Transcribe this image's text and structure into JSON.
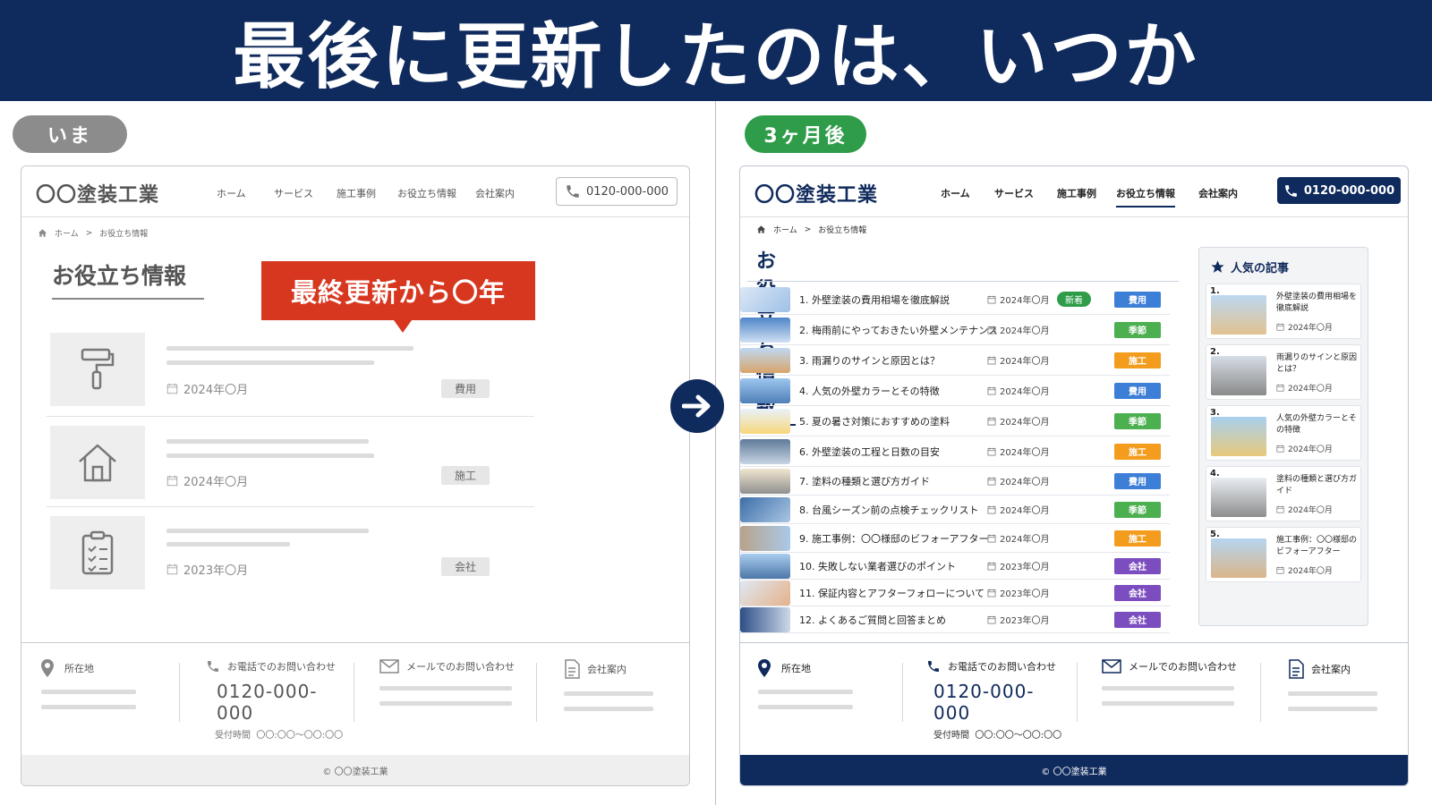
{
  "headline": "最後に更新したのは、いつか",
  "labels": {
    "now": "いま",
    "later": "3ヶ月後"
  },
  "site": {
    "logo": "〇〇塗装工業",
    "menu": [
      "ホーム",
      "サービス",
      "施工事例",
      "お役立ち情報",
      "会社案内"
    ],
    "phone": "0120-000-000",
    "breadcrumb": [
      "ホーム",
      "お役立ち情報"
    ],
    "page_title": "お役立ち情報",
    "copyright": "© 〇〇塗装工業"
  },
  "footer": {
    "address": "所在地",
    "tel_label": "お電話でのお問い合わせ",
    "tel_number": "0120-000-000",
    "hours_label": "受付時間",
    "hours": "〇〇:〇〇〜〇〇:〇〇",
    "mail_label": "メールでのお問い合わせ",
    "company": "会社案内"
  },
  "left": {
    "callout": "最終更新から〇年",
    "rows": [
      {
        "icon": "paint-roller-icon",
        "date": "2024年〇月",
        "tag": "費用"
      },
      {
        "icon": "house-icon",
        "date": "2024年〇月",
        "tag": "施工"
      },
      {
        "icon": "clipboard-icon",
        "date": "2023年〇月",
        "tag": "会社"
      }
    ]
  },
  "right": {
    "new_badge": "新着",
    "articles": [
      {
        "no": "1.",
        "title": "外壁塗装の費用相場を徹底解説",
        "date": "2024年〇月",
        "tag": "費用",
        "new": true
      },
      {
        "no": "2.",
        "title": "梅雨前にやっておきたい外壁メンテナンス",
        "date": "2024年〇月",
        "tag": "季節"
      },
      {
        "no": "3.",
        "title": "雨漏りのサインと原因とは？",
        "date": "2024年〇月",
        "tag": "施工"
      },
      {
        "no": "4.",
        "title": "人気の外壁カラーとその特徴",
        "date": "2024年〇月",
        "tag": "費用"
      },
      {
        "no": "5.",
        "title": "夏の暑さ対策におすすめの塗料",
        "date": "2024年〇月",
        "tag": "季節"
      },
      {
        "no": "6.",
        "title": "外壁塗装の工程と日数の目安",
        "date": "2024年〇月",
        "tag": "施工"
      },
      {
        "no": "7.",
        "title": "塗料の種類と選び方ガイド",
        "date": "2024年〇月",
        "tag": "費用"
      },
      {
        "no": "8.",
        "title": "台風シーズン前の点検チェックリスト",
        "date": "2024年〇月",
        "tag": "季節"
      },
      {
        "no": "9.",
        "title": "施工事例：〇〇様邸のビフォーアフター",
        "date": "2024年〇月",
        "tag": "施工"
      },
      {
        "no": "10.",
        "title": "失敗しない業者選びのポイント",
        "date": "2023年〇月",
        "tag": "会社"
      },
      {
        "no": "11.",
        "title": "保証内容とアフターフォローについて",
        "date": "2023年〇月",
        "tag": "会社"
      },
      {
        "no": "12.",
        "title": "よくあるご質問と回答まとめ",
        "date": "2023年〇月",
        "tag": "会社"
      }
    ],
    "popular_title": "人気の記事",
    "popular": [
      {
        "no": "1.",
        "title": "外壁塗装の費用相場を徹底解説",
        "date": "2024年〇月"
      },
      {
        "no": "2.",
        "title": "雨漏りのサインと原因とは？",
        "date": "2024年〇月"
      },
      {
        "no": "3.",
        "title": "人気の外壁カラーとその特徴",
        "date": "2024年〇月"
      },
      {
        "no": "4.",
        "title": "塗料の種類と選び方ガイド",
        "date": "2024年〇月"
      },
      {
        "no": "5.",
        "title": "施工事例：〇〇様邸のビフォーアフター",
        "date": "2024年〇月"
      }
    ]
  },
  "colors": {
    "navy": "#0f2a5c",
    "費用": "#3d7fd6",
    "季節": "#4caf50",
    "施工": "#f39c1e",
    "会社": "#7c4dbf",
    "callout": "#d8371f"
  }
}
